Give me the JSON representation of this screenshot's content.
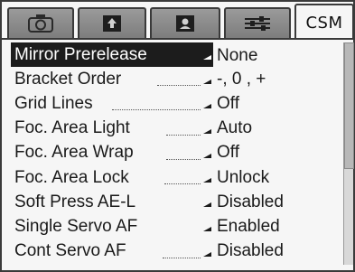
{
  "tabs": [
    {
      "icon": "camera-icon",
      "label": ""
    },
    {
      "icon": "shooting-menu-icon",
      "label": ""
    },
    {
      "icon": "personal-icon",
      "label": ""
    },
    {
      "icon": "setup-sliders-icon",
      "label": ""
    },
    {
      "icon": "",
      "label": "CSM",
      "active": true
    }
  ],
  "menu": {
    "items": [
      {
        "label": "Mirror Prerelease",
        "value": "None"
      },
      {
        "label": "Bracket Order",
        "value": "-, 0 , +"
      },
      {
        "label": "Grid Lines",
        "value": "Off"
      },
      {
        "label": "Foc. Area Light",
        "value": "Auto"
      },
      {
        "label": "Foc. Area Wrap",
        "value": "Off"
      },
      {
        "label": "Foc. Area Lock",
        "value": "Unlock"
      },
      {
        "label": "Soft Press AE-L",
        "value": "Disabled"
      },
      {
        "label": "Single Servo AF",
        "value": "Enabled"
      },
      {
        "label": "Cont Servo AF",
        "value": "Disabled"
      }
    ],
    "selected_index": 0
  },
  "colors": {
    "selection": "#1c1c1c",
    "background": "#f6f6f6",
    "tab_inactive": "#8a8a8a"
  }
}
